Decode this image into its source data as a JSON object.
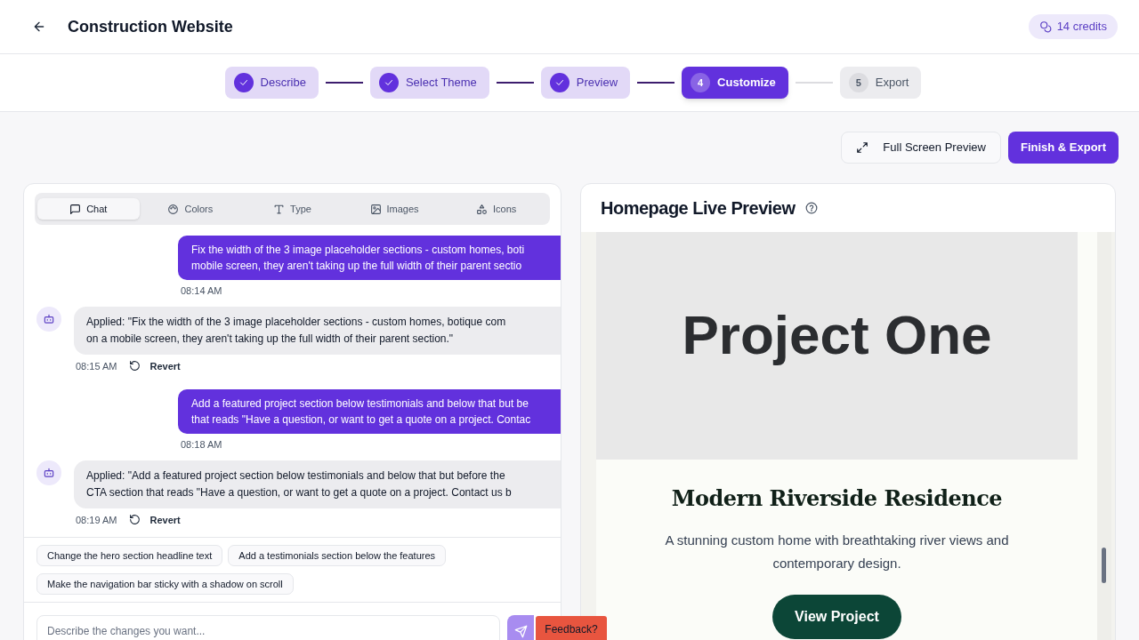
{
  "header": {
    "title": "Construction Website",
    "credits": "14 credits"
  },
  "steps": [
    {
      "label": "Describe",
      "kind": "done"
    },
    {
      "label": "Select Theme",
      "kind": "done"
    },
    {
      "label": "Preview",
      "kind": "done"
    },
    {
      "label": "Customize",
      "number": "4",
      "kind": "current"
    },
    {
      "label": "Export",
      "number": "5",
      "kind": "pending"
    }
  ],
  "actions": {
    "full_screen": "Full Screen Preview",
    "finish": "Finish & Export"
  },
  "chat_panel": {
    "tabs": [
      {
        "label": "Chat",
        "selected": true
      },
      {
        "label": "Colors",
        "selected": false
      },
      {
        "label": "Type",
        "selected": false
      },
      {
        "label": "Images",
        "selected": false
      },
      {
        "label": "Icons",
        "selected": false
      }
    ],
    "messages": [
      {
        "kind": "user",
        "lines": [
          "Fix the width of the 3 image placeholder sections - custom homes, boti",
          "mobile screen, they aren't taking up the full width of their parent sectio"
        ],
        "time": "08:14 AM"
      },
      {
        "kind": "bot",
        "lines": [
          "Applied: \"Fix the width of the 3 image placeholder sections - custom homes, botique com",
          "on a mobile screen, they aren't taking up the full width of their parent section.\""
        ],
        "time": "08:15 AM",
        "action": "Revert"
      },
      {
        "kind": "user",
        "lines": [
          "Add a featured project section below testimonials and below that but be",
          "that reads \"Have a question, or want to get a quote on a project. Contac"
        ],
        "time": "08:18 AM"
      },
      {
        "kind": "bot",
        "lines": [
          "Applied: \"Add a featured project section below testimonials and below that but before the",
          "CTA section that reads \"Have a question, or want to get a quote on a project. Contact us b"
        ],
        "time": "08:19 AM",
        "action": "Revert"
      }
    ],
    "suggestions": [
      "Change the hero section headline text",
      "Add a testimonials section below the features",
      "Make the navigation bar sticky with a shadow on scroll"
    ],
    "input": {
      "placeholder": "Describe the changes you want..."
    }
  },
  "preview_panel": {
    "title": "Homepage Live Preview",
    "image_text": "Project One",
    "project_title": "Modern Riverside Residence",
    "description": "A stunning custom home with breathtaking river views and contemporary design.",
    "button": "View Project"
  },
  "feedback": "Feedback?"
}
